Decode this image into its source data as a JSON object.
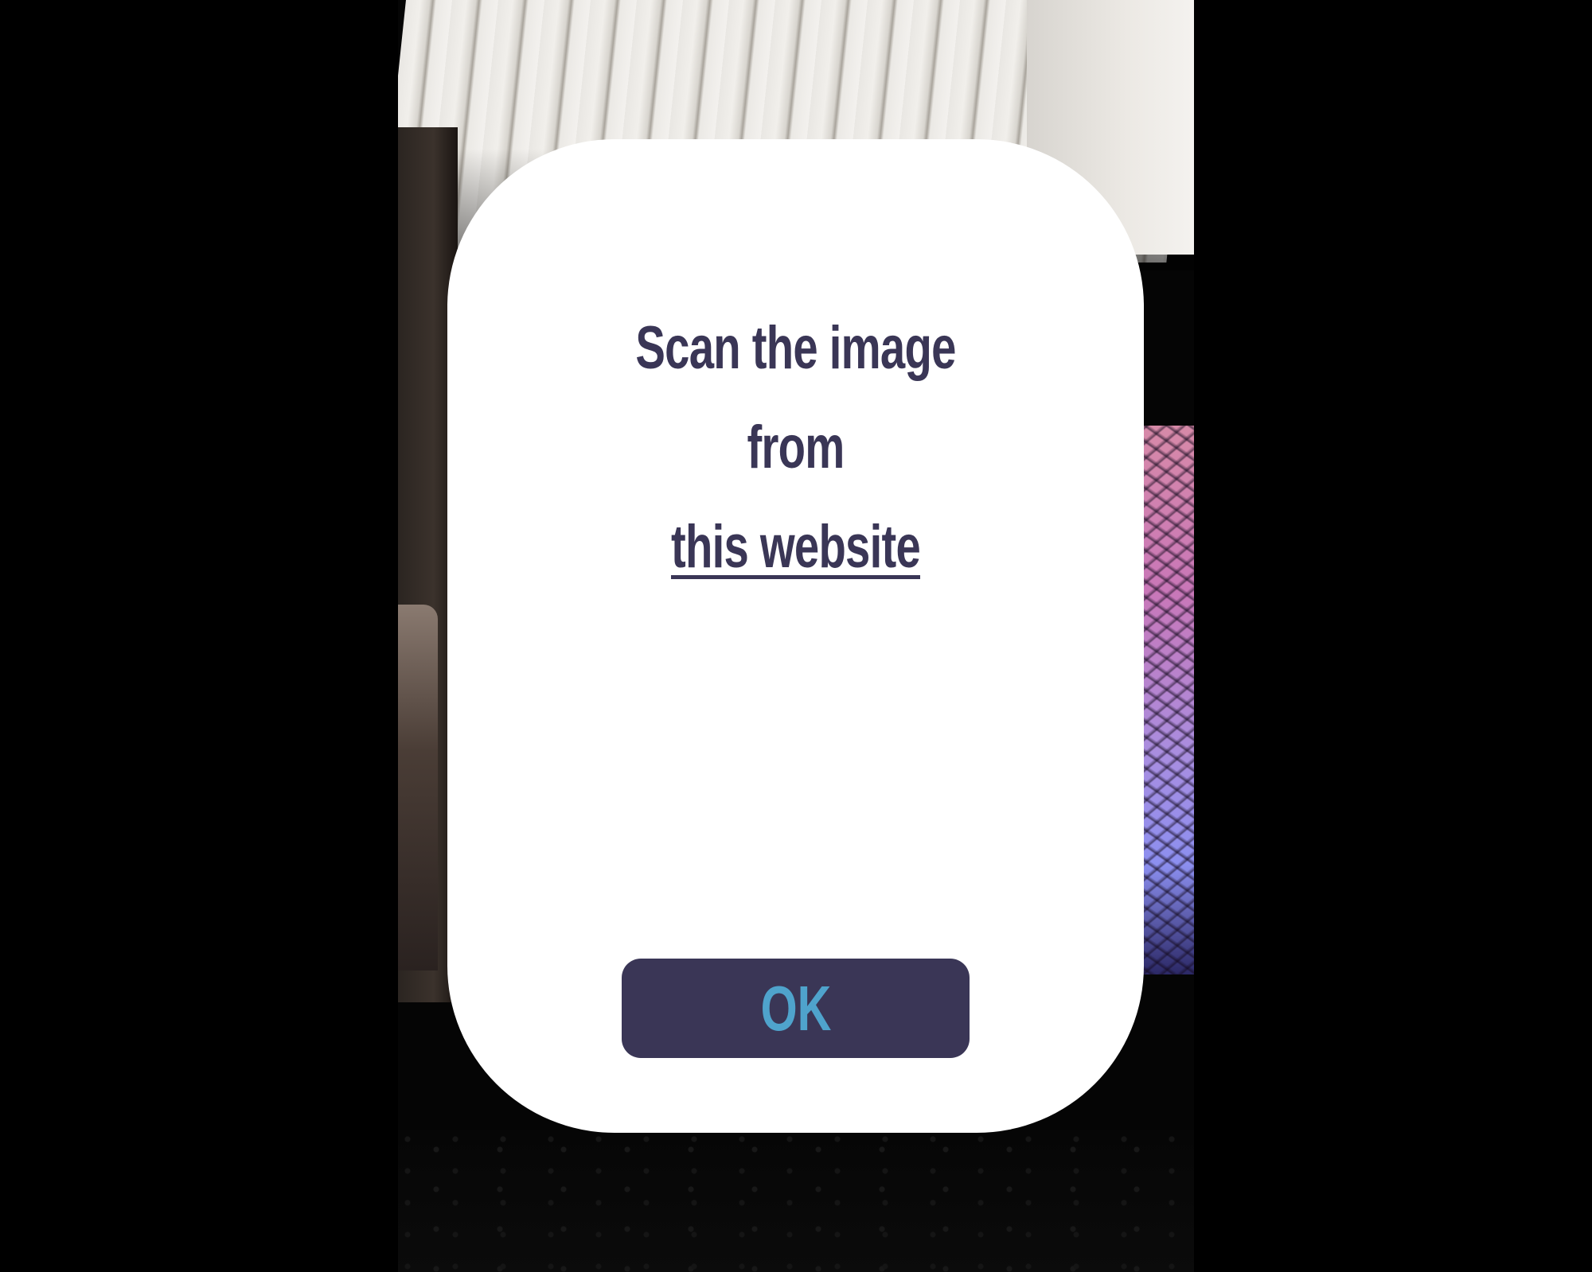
{
  "colors": {
    "background": "#000000",
    "card": "#ffffff",
    "text": "#3a3656",
    "button_bg": "#3a3656",
    "button_text": "#4fa3cc"
  },
  "camera": {
    "description_icon": "camera-feed"
  },
  "modal": {
    "message_line1": "Scan the image",
    "message_line2": "from",
    "link_text": "this website",
    "ok_label": "OK"
  }
}
